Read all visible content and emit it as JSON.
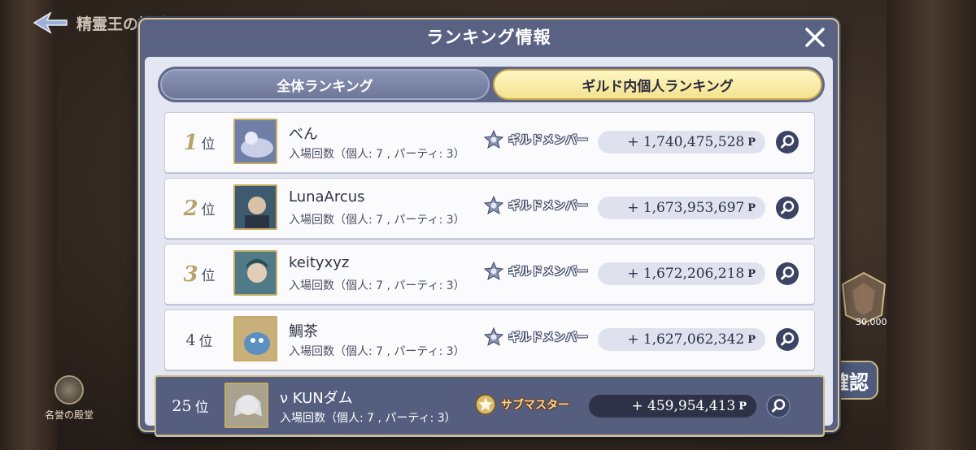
{
  "background": {
    "title": "精霊王の試練",
    "hall_label": "名誉の殿堂",
    "badge_value": "30,000",
    "confirm_label": "確認"
  },
  "modal": {
    "title": "ランキング情報",
    "close_icon": "close-icon"
  },
  "tabs": [
    {
      "label": "全体ランキング",
      "active": false
    },
    {
      "label": "ギルド内個人ランキング",
      "active": true
    }
  ],
  "rank_suffix": "位",
  "rows": [
    {
      "rank": "1",
      "name": "べん",
      "entries": "入場回数（個人: 7 , パーティ: 3）",
      "role": "ギルドメンバー",
      "points": "+ 1,740,475,528",
      "unit": "P",
      "avatar_color": "#6f7fa8"
    },
    {
      "rank": "2",
      "name": "LunaArcus",
      "entries": "入場回数（個人: 7 , パーティ: 3）",
      "role": "ギルドメンバー",
      "points": "+ 1,673,953,697",
      "unit": "P",
      "avatar_color": "#3d5a6e"
    },
    {
      "rank": "3",
      "name": "keityxyz",
      "entries": "入場回数（個人: 7 , パーティ: 3）",
      "role": "ギルドメンバー",
      "points": "+ 1,672,206,218",
      "unit": "P",
      "avatar_color": "#4f7a86"
    },
    {
      "rank": "4",
      "name": "鯛茶",
      "entries": "入場回数（個人: 7 , パーティ: 3）",
      "role": "ギルドメンバー",
      "points": "+ 1,627,062,342",
      "unit": "P",
      "avatar_color": "#5b8fbf"
    },
    {
      "rank": "25",
      "name": "ν KUNダム",
      "entries": "入場回数（個人: 7 , パーティ: 3）",
      "role": "サブマスター",
      "points": "+ 459,954,413",
      "unit": "P",
      "avatar_color": "#a8a28e"
    }
  ]
}
